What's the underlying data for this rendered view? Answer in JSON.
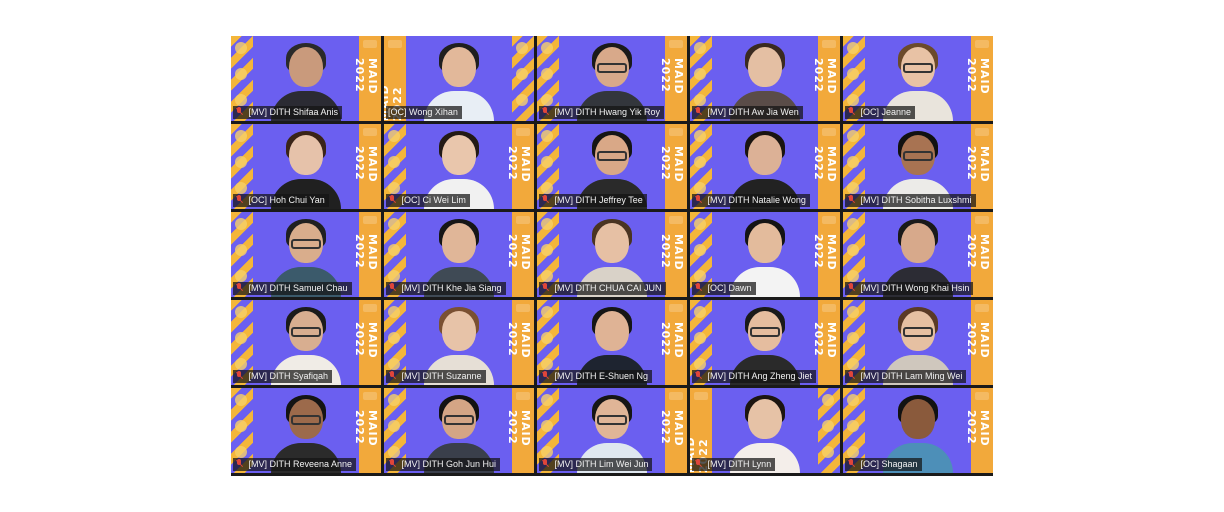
{
  "banner_text": "MAID 2022",
  "accent": {
    "purple": "#6b5ff0",
    "yellow": "#f2a93b",
    "active_border": "#7ad13a"
  },
  "participants": [
    {
      "name": "[MV] DITH Shifaa Anis",
      "muted": true
    },
    {
      "name": "[OC] Wong Xihan",
      "muted": false,
      "active": true,
      "mirrored": true
    },
    {
      "name": "[MV] DITH Hwang Yik Roy",
      "muted": true
    },
    {
      "name": "[MV] DITH Aw Jia Wen",
      "muted": true
    },
    {
      "name": "[OC] Jeanne",
      "muted": true
    },
    {
      "name": "[OC] Hoh Chui Yan",
      "muted": true
    },
    {
      "name": "[OC] Ci Wei Lim",
      "muted": true
    },
    {
      "name": "[MV] DITH Jeffrey Tee",
      "muted": true
    },
    {
      "name": "[MV] DITH Natalie Wong",
      "muted": true
    },
    {
      "name": "[MV] DITH Sobitha Luxshmi",
      "muted": true
    },
    {
      "name": "[MV] DITH Samuel Chau",
      "muted": true
    },
    {
      "name": "[MV] DITH Khe Jia Siang",
      "muted": true
    },
    {
      "name": "[MV] DITH CHUA CAI JUN",
      "muted": true
    },
    {
      "name": "[OC] Dawn",
      "muted": true
    },
    {
      "name": "[MV] DITH Wong Khai Hsin",
      "muted": true
    },
    {
      "name": "[MV] DITH Syafiqah",
      "muted": true
    },
    {
      "name": "[MV] DITH Suzanne",
      "muted": true
    },
    {
      "name": "[MV] DITH E-Shuen Ng",
      "muted": true
    },
    {
      "name": "[MV] DITH Ang Zheng Jiet",
      "muted": true
    },
    {
      "name": "[MV] DITH Lam Ming Wei",
      "muted": true
    },
    {
      "name": "[MV] DITH Reveena Anne",
      "muted": true
    },
    {
      "name": "[MV] DITH Goh Jun Hui",
      "muted": true
    },
    {
      "name": "[MV] DITH Lim Wei Jun",
      "muted": true
    },
    {
      "name": "[MV] DITH Lynn",
      "muted": true,
      "mirrored": true
    },
    {
      "name": "[OC] Shagaan",
      "muted": true
    }
  ]
}
